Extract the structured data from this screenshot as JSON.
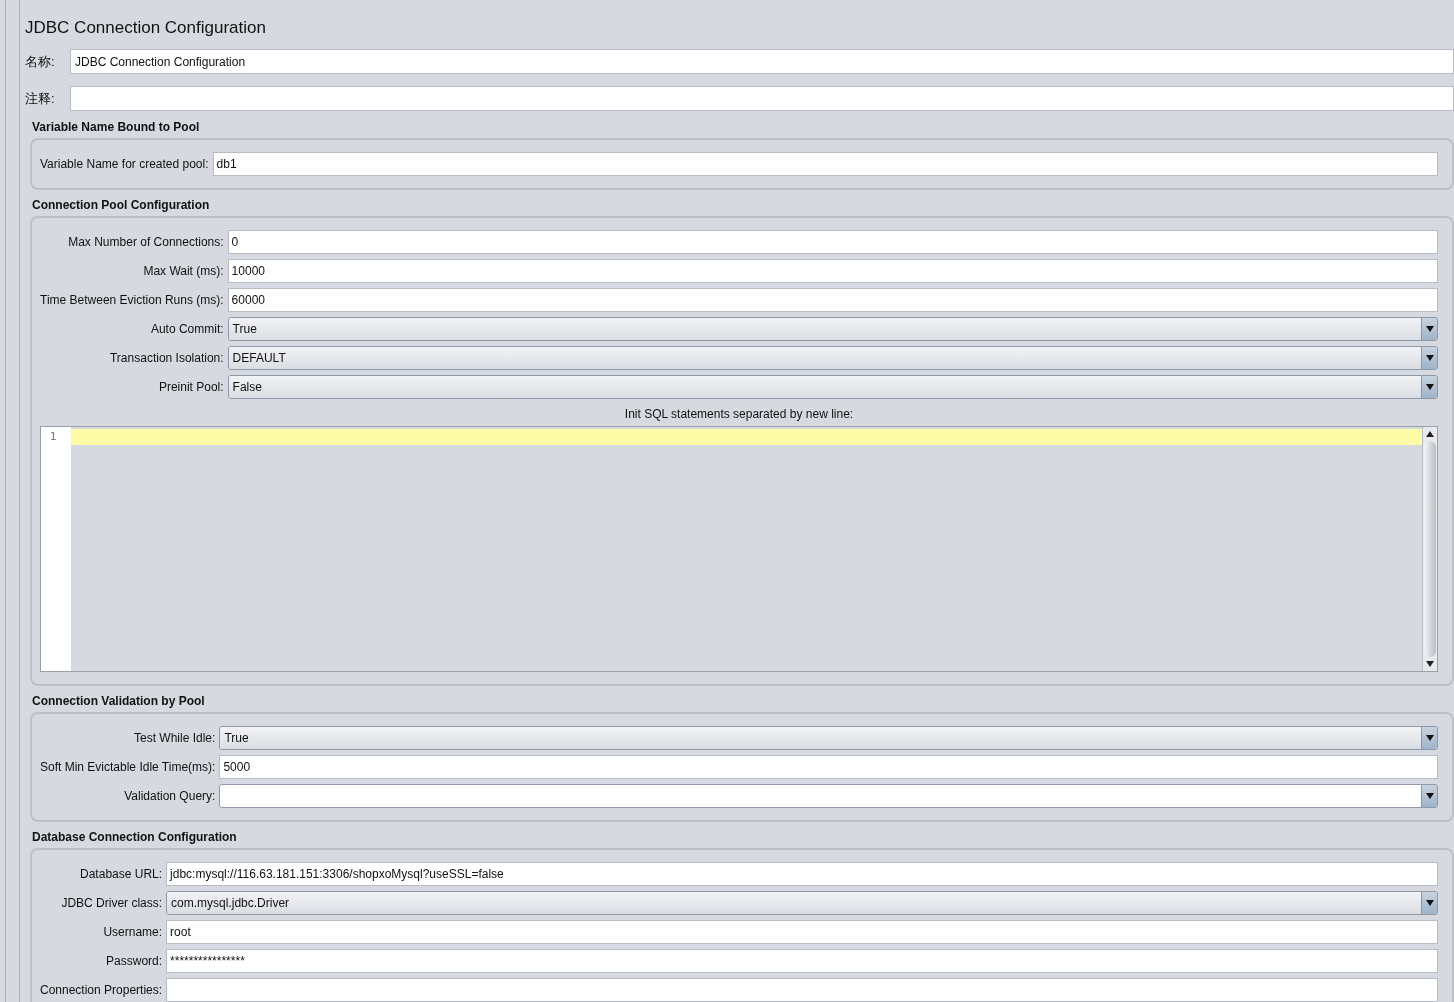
{
  "title": "JDBC Connection Configuration",
  "name_field": {
    "label": "名称:",
    "value": "JDBC Connection Configuration"
  },
  "comment_field": {
    "label": "注释:"
  },
  "sections": [
    {
      "title": "Variable Name Bound to Pool",
      "rows": [
        {
          "kind": "text",
          "label": "Variable Name for created pool:",
          "value": "db1"
        }
      ]
    },
    {
      "title": "Connection Pool Configuration",
      "rows": [
        {
          "kind": "text",
          "label": "Max Number of Connections:",
          "value": "0"
        },
        {
          "kind": "text",
          "label": "Max Wait (ms):",
          "value": "10000"
        },
        {
          "kind": "text",
          "label": "Time Between Eviction Runs (ms):",
          "value": "60000"
        },
        {
          "kind": "select",
          "label": "Auto Commit:",
          "value": "True"
        },
        {
          "kind": "select",
          "label": "Transaction Isolation:",
          "value": "DEFAULT"
        },
        {
          "kind": "select",
          "label": "Preinit Pool:",
          "value": "False"
        }
      ],
      "editor": {
        "label": "Init SQL statements separated by new line:",
        "line_numbers": [
          "1"
        ]
      }
    },
    {
      "title": "Connection Validation by Pool",
      "rows": [
        {
          "kind": "select",
          "label": "Test While Idle:",
          "value": "True"
        },
        {
          "kind": "text",
          "label": "Soft Min Evictable Idle Time(ms):",
          "value": "5000"
        },
        {
          "kind": "combo",
          "label": "Validation Query:"
        }
      ]
    },
    {
      "title": "Database Connection Configuration",
      "rows": [
        {
          "kind": "text",
          "label": "Database URL:",
          "value": "jdbc:mysql://116.63.181.151:3306/shopxoMysql?useSSL=false"
        },
        {
          "kind": "select",
          "label": "JDBC Driver class:",
          "value": "com.mysql.jdbc.Driver"
        },
        {
          "kind": "text",
          "label": "Username:",
          "value": "root"
        },
        {
          "kind": "text",
          "label": "Password:",
          "value": "****************"
        },
        {
          "kind": "text",
          "label": "Connection Properties:"
        }
      ]
    }
  ]
}
